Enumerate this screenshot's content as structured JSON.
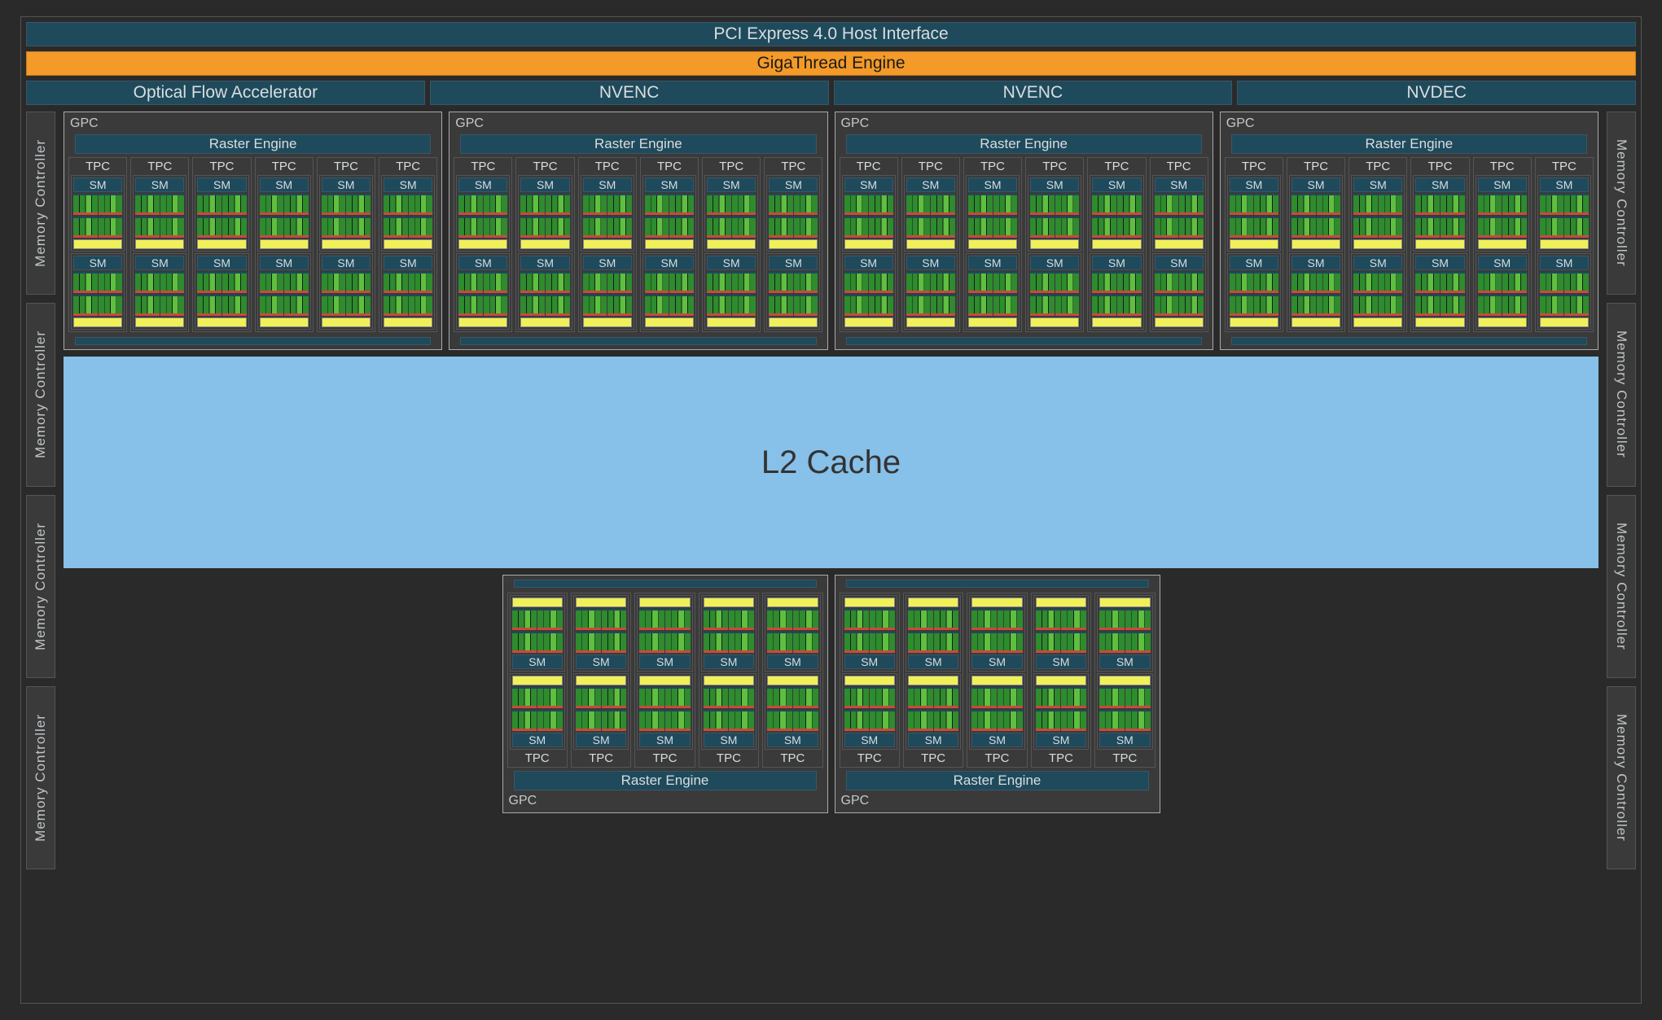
{
  "top": {
    "pci": "PCI Express 4.0 Host Interface",
    "giga": "GigaThread Engine",
    "ofa": "Optical Flow Accelerator",
    "nvenc": "NVENC",
    "nvdec": "NVDEC"
  },
  "labels": {
    "memctrl": "Memory Controller",
    "gpc": "GPC",
    "raster": "Raster Engine",
    "tpc": "TPC",
    "sm": "SM",
    "l2": "L2 Cache"
  },
  "layout": {
    "top_gpc_count": 4,
    "top_tpc_per_gpc": 6,
    "bottom_gpc_count": 2,
    "bottom_tpc_per_gpc": 5,
    "sm_per_tpc": 2,
    "mem_controllers_per_side": 4
  }
}
